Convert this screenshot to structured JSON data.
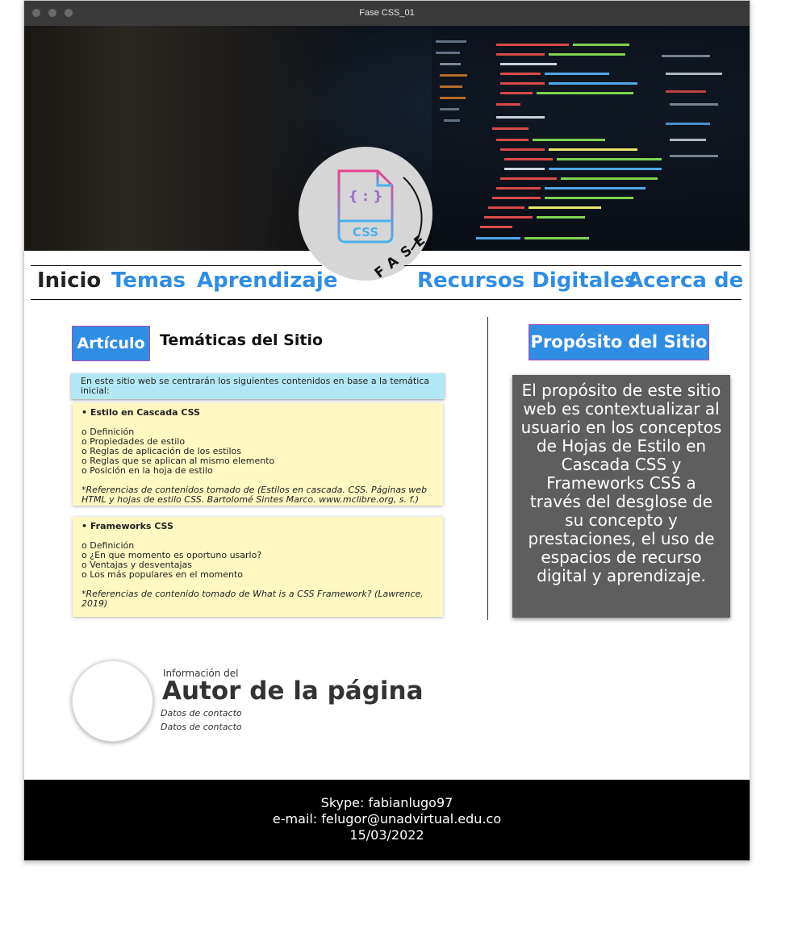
{
  "window": {
    "title": "Fase CSS_01"
  },
  "hero": {
    "logo_text": "CSS",
    "logo_curved_text": "FASE",
    "logo_braces": "{ : }"
  },
  "nav": {
    "items": [
      {
        "label": "Inicio"
      },
      {
        "label": "Temas"
      },
      {
        "label": "Aprendizaje"
      },
      {
        "label": "Recursos Digitales"
      },
      {
        "label": "Acerca de"
      }
    ]
  },
  "article": {
    "label": "Artículo",
    "title": "Temáticas del Sitio",
    "intro": "En este sitio web se centrarán los siguientes contenidos en base a la temática inicial:",
    "cards": [
      {
        "heading": "• Estilo en Cascada CSS",
        "items": [
          "o Definición",
          "o Propiedades de estilo",
          "o Reglas de aplicación de los estilos",
          "o Reglas que se aplican al mismo elemento",
          "o Posición en la hoja de estilo"
        ],
        "reference": "*Referencias de contenidos tomado de (Estilos en cascada. CSS. Páginas web HTML y hojas de estilo CSS. Bartolomé Sintes Marco. www.mclibre.org, s. f.)"
      },
      {
        "heading": "• Frameworks CSS",
        "items": [
          "o Definición",
          "o ¿En que momento es oportuno usarlo?",
          "o Ventajas y desventajas",
          "o Los más populares en el momento"
        ],
        "reference": "*Referencias de contenido tomado de What is a CSS Framework? (Lawrence, 2019)"
      }
    ]
  },
  "purpose": {
    "label": "Propósito del Sitio",
    "text": "El propósito de este sitio web es contextualizar al usuario en los conceptos de Hojas de Estilo en Cascada CSS y Frameworks CSS a través del desglose de su concepto y prestaciones, el uso de espacios de recurso digital y aprendizaje."
  },
  "author": {
    "small": "Información del",
    "title": "Autor de la página",
    "contacts": [
      "Datos de contacto",
      "Datos de contacto"
    ]
  },
  "footer": {
    "skype": "Skype: fabianlugo97",
    "email": "e-mail: felugor@unadvirtual.edu.co",
    "date": "15/03/2022"
  },
  "colors": {
    "accent": "#2f8de4",
    "accent_border": "#b04cb8",
    "intro_bg": "#b2e8f5",
    "note_bg": "#fff8c2",
    "purpose_bg": "#5e5e5e",
    "footer_bg": "#000000"
  }
}
